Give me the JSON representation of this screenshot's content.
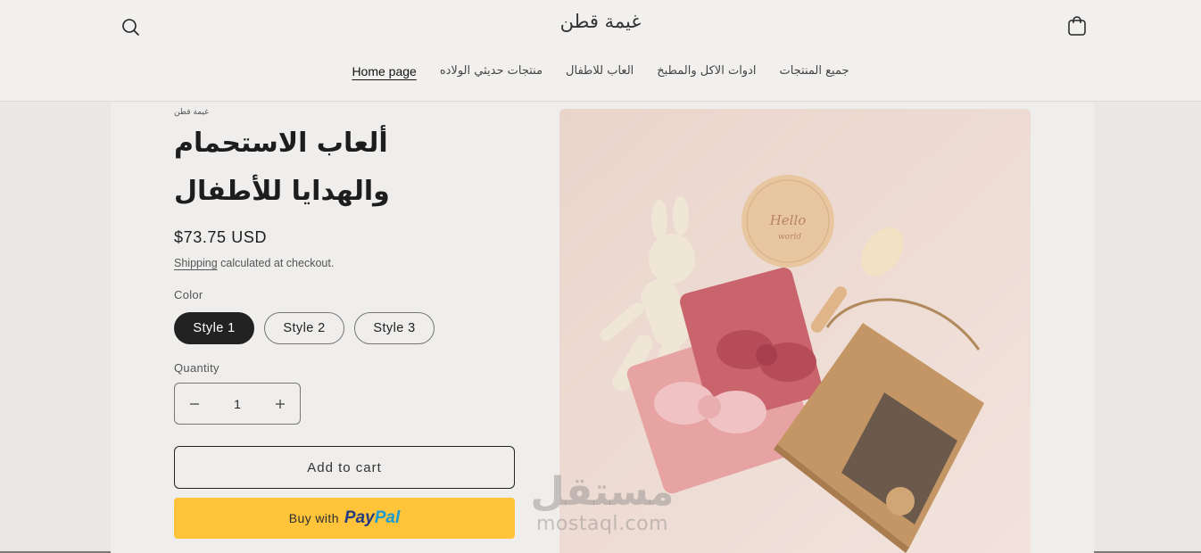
{
  "header": {
    "brand": "غيمة قطن",
    "search_icon": "search-icon",
    "cart_icon": "shopping-bag-icon"
  },
  "nav": {
    "items": [
      {
        "label": "Home page",
        "active": true
      },
      {
        "label": "منتجات حديثي الولاده",
        "active": false
      },
      {
        "label": "العاب للاطفال",
        "active": false
      },
      {
        "label": "ادوات الاكل والمطبخ",
        "active": false
      },
      {
        "label": "جميع المنتجات",
        "active": false
      }
    ]
  },
  "product": {
    "vendor": "غيمة قطن",
    "title": "ألعاب الاستحمام والهدايا للأطفال",
    "price": "$73.75 USD",
    "shipping_link": "Shipping",
    "shipping_text": " calculated at checkout.",
    "color_label": "Color",
    "styles": [
      "Style 1",
      "Style 2",
      "Style 3"
    ],
    "selected_style": "Style 1",
    "quantity_label": "Quantity",
    "quantity": "1",
    "minus_icon": "minus-icon",
    "plus_icon": "plus-icon",
    "add_to_cart": "Add to cart",
    "paypal_prefix": "Buy with",
    "paypal_brand_1": "Pay",
    "paypal_brand_2": "Pal"
  },
  "watermark": {
    "arabic": "مستقل",
    "latin": "mostaql.com"
  },
  "colors": {
    "paypal_button": "#ffc43a",
    "selected_pill": "#222222",
    "page_bg": "#efeeec"
  }
}
